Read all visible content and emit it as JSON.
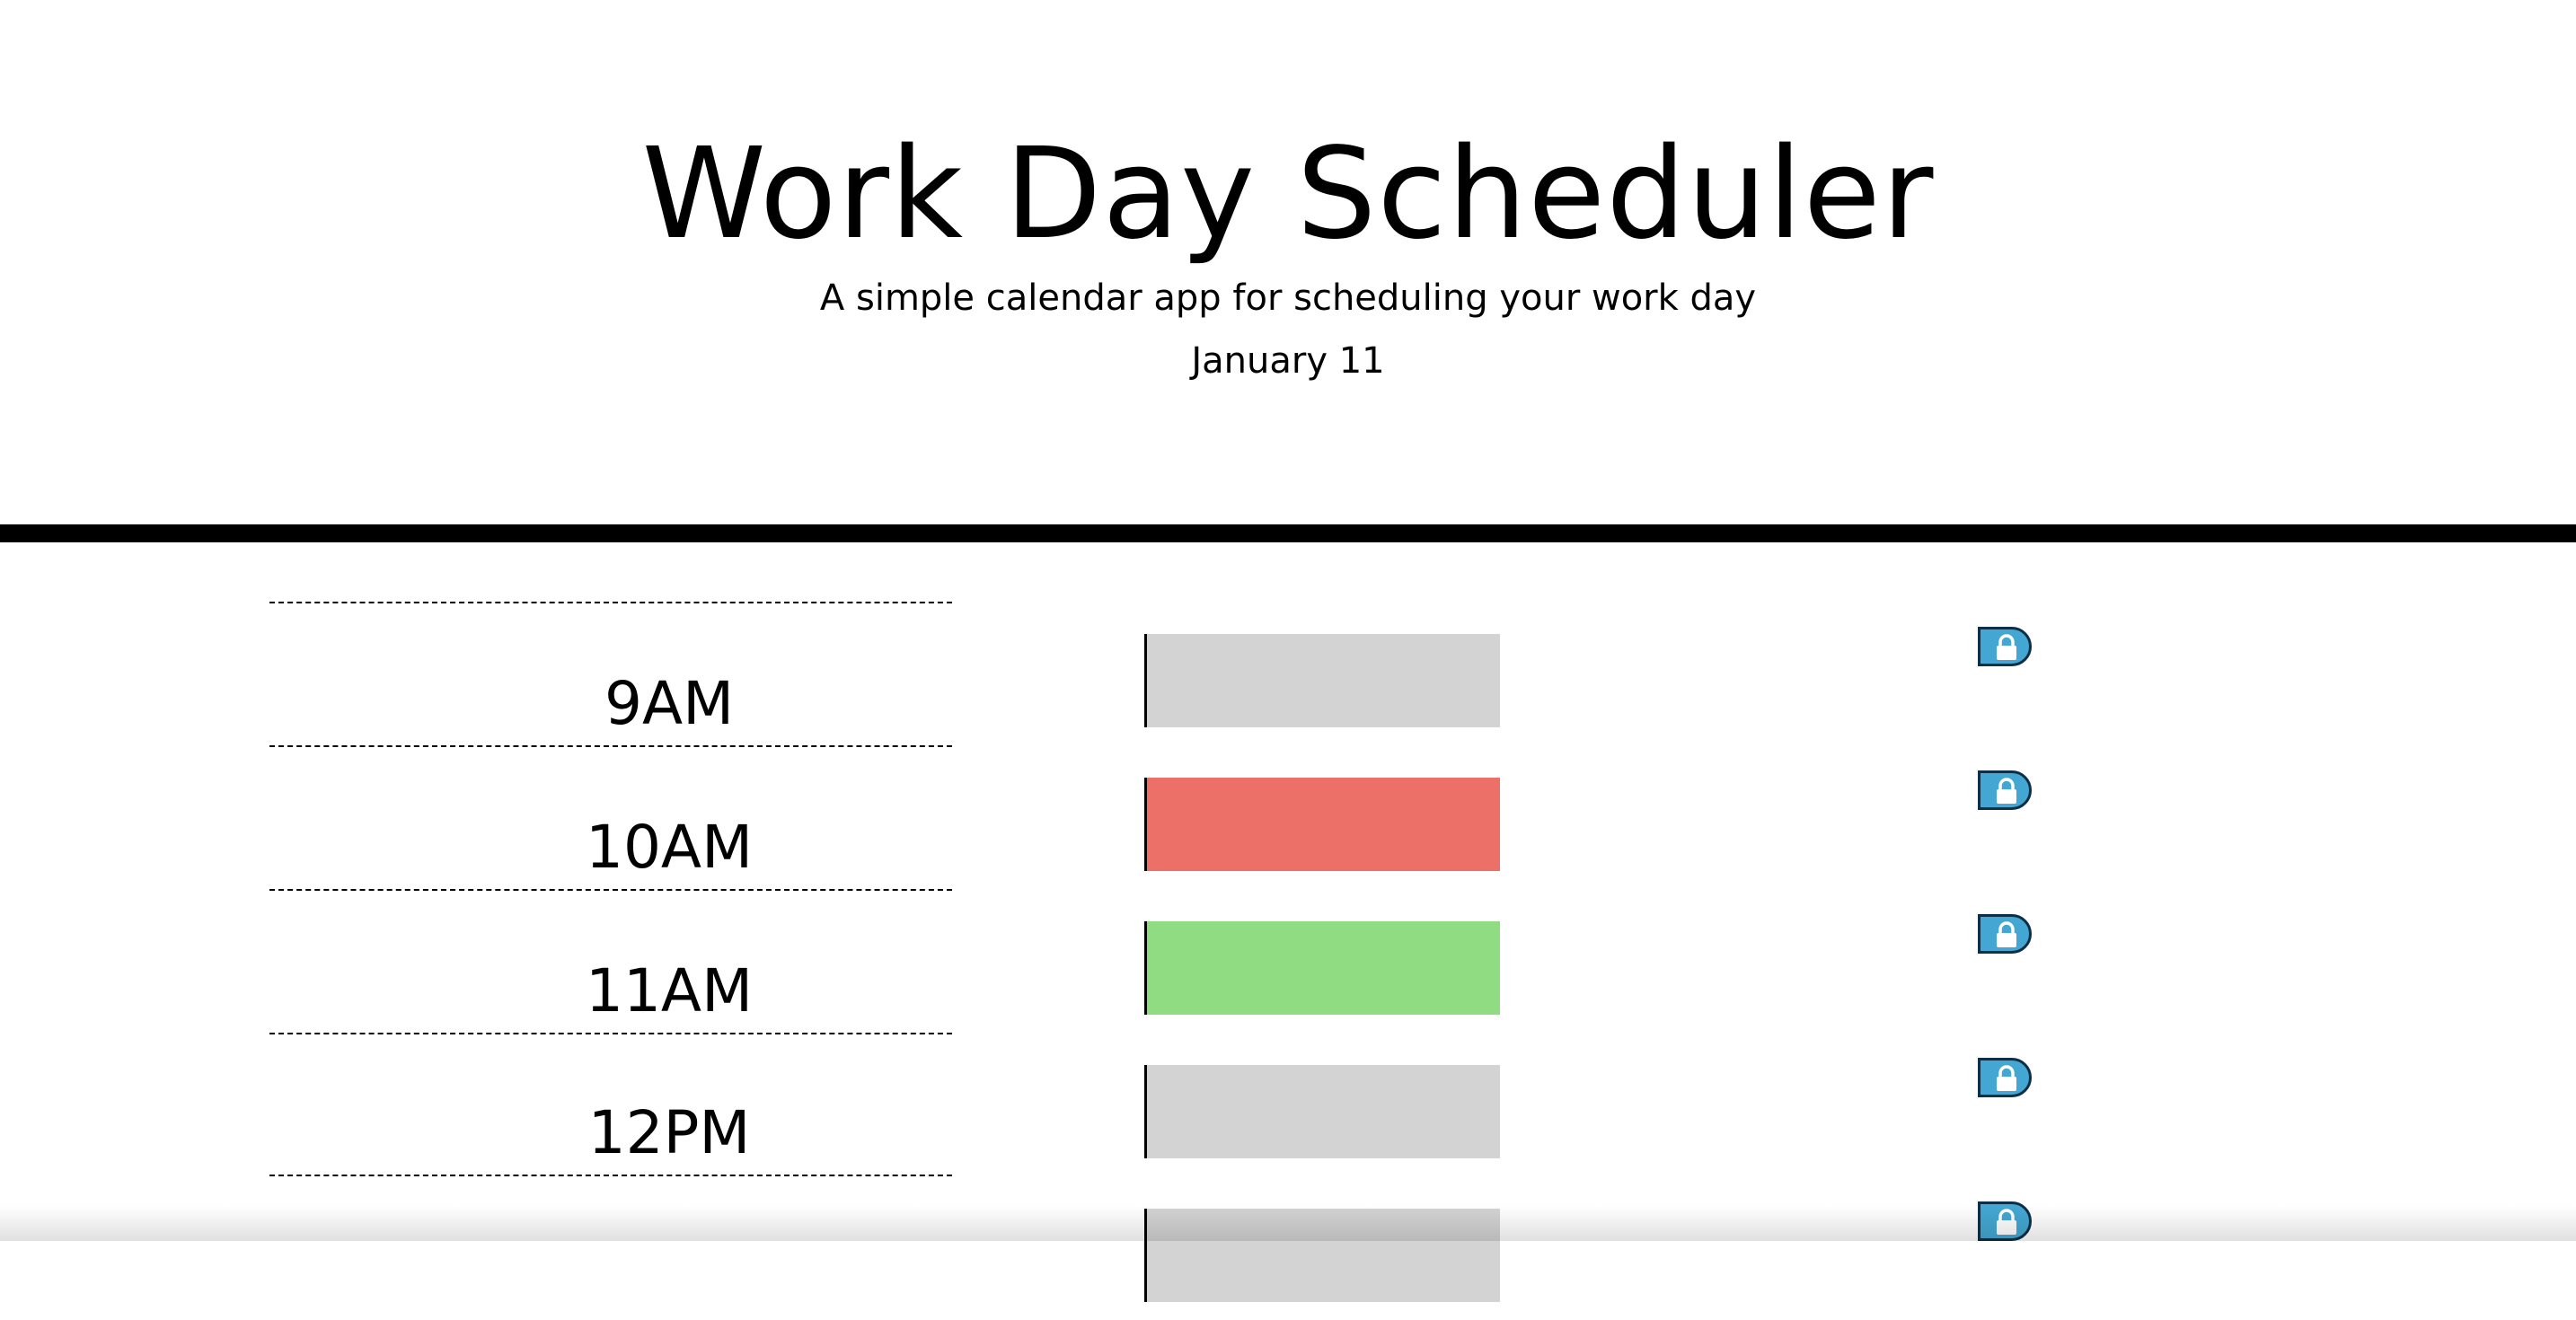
{
  "header": {
    "title": "Work Day Scheduler",
    "lead": "A simple calendar app for scheduling your work day",
    "current_day": "January 11"
  },
  "time_blocks": [
    {
      "hour": "9AM",
      "status": "past",
      "description": "",
      "save_icon": "lock-icon"
    },
    {
      "hour": "10AM",
      "status": "present",
      "description": "",
      "save_icon": "lock-icon"
    },
    {
      "hour": "11AM",
      "status": "future",
      "description": "",
      "save_icon": "lock-icon"
    },
    {
      "hour": "12PM",
      "status": "past",
      "description": "",
      "save_icon": "lock-icon"
    },
    {
      "hour": "",
      "status": "past",
      "description": "",
      "save_icon": "lock-icon"
    }
  ],
  "colors": {
    "past": "#d3d3d3",
    "present": "#ed7068",
    "future": "#90dc82",
    "save_button": "#44a7d3",
    "divider": "#000000"
  }
}
